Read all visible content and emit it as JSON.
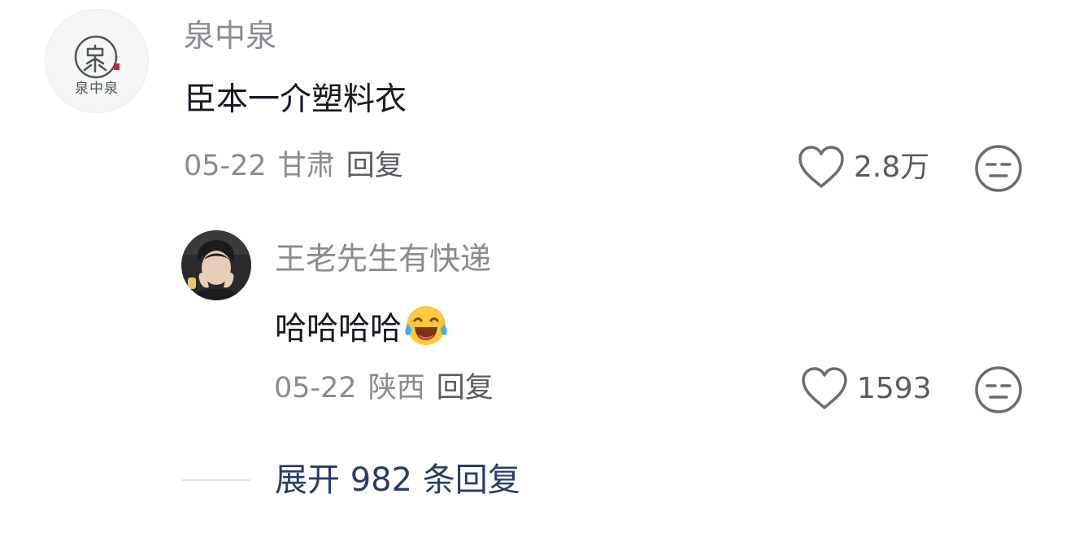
{
  "comment": {
    "avatar_brand": "泉中泉",
    "username": "泉中泉",
    "text": "臣本一介塑料衣",
    "date": "05-22",
    "region": "甘肃",
    "reply_label": "回复",
    "like_count": "2.8万"
  },
  "reply": {
    "username": "王老先生有快递",
    "text": "哈哈哈哈",
    "emoji": "laughing-tears-emoji",
    "date": "05-22",
    "region": "陕西",
    "reply_label": "回复",
    "like_count": "1593"
  },
  "expand": {
    "label": "展开 982 条回复"
  },
  "icons": {
    "like": "heart-outline-icon",
    "dislike": "meh-face-icon"
  },
  "colors": {
    "username": "#8a8b91",
    "text": "#161823",
    "expand_link": "#2a3b66"
  }
}
